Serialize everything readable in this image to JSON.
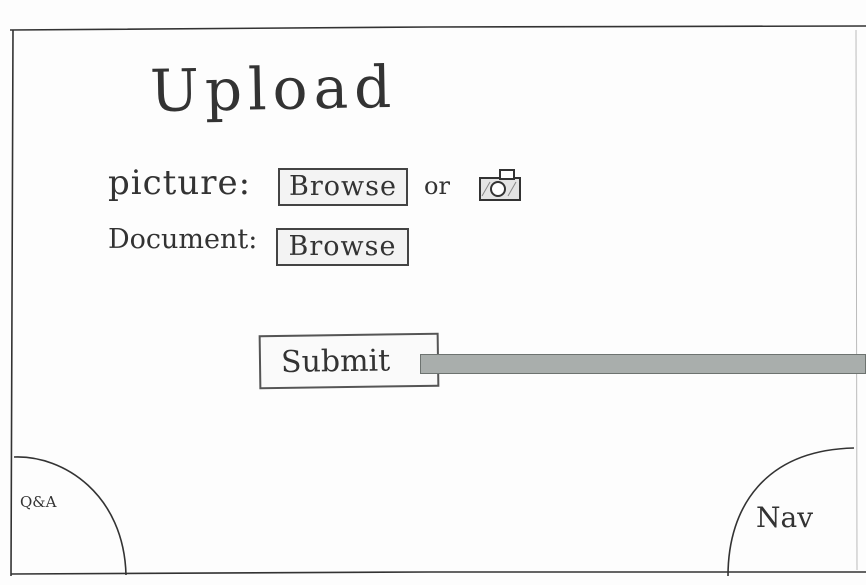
{
  "page": {
    "title": "Upload"
  },
  "form": {
    "picture_label": "picture:",
    "picture_browse_label": "Browse",
    "or_text": "or",
    "document_label": "Document:",
    "document_browse_label": "Browse",
    "submit_label": "Submit"
  },
  "corners": {
    "qa_label": "Q&A",
    "nav_label": "Nav"
  },
  "icons": {
    "camera": "camera-icon"
  },
  "colors": {
    "ink": "#2e2e2e",
    "callout_bar": "#a9aeac",
    "paper": "#fdfdfd"
  }
}
